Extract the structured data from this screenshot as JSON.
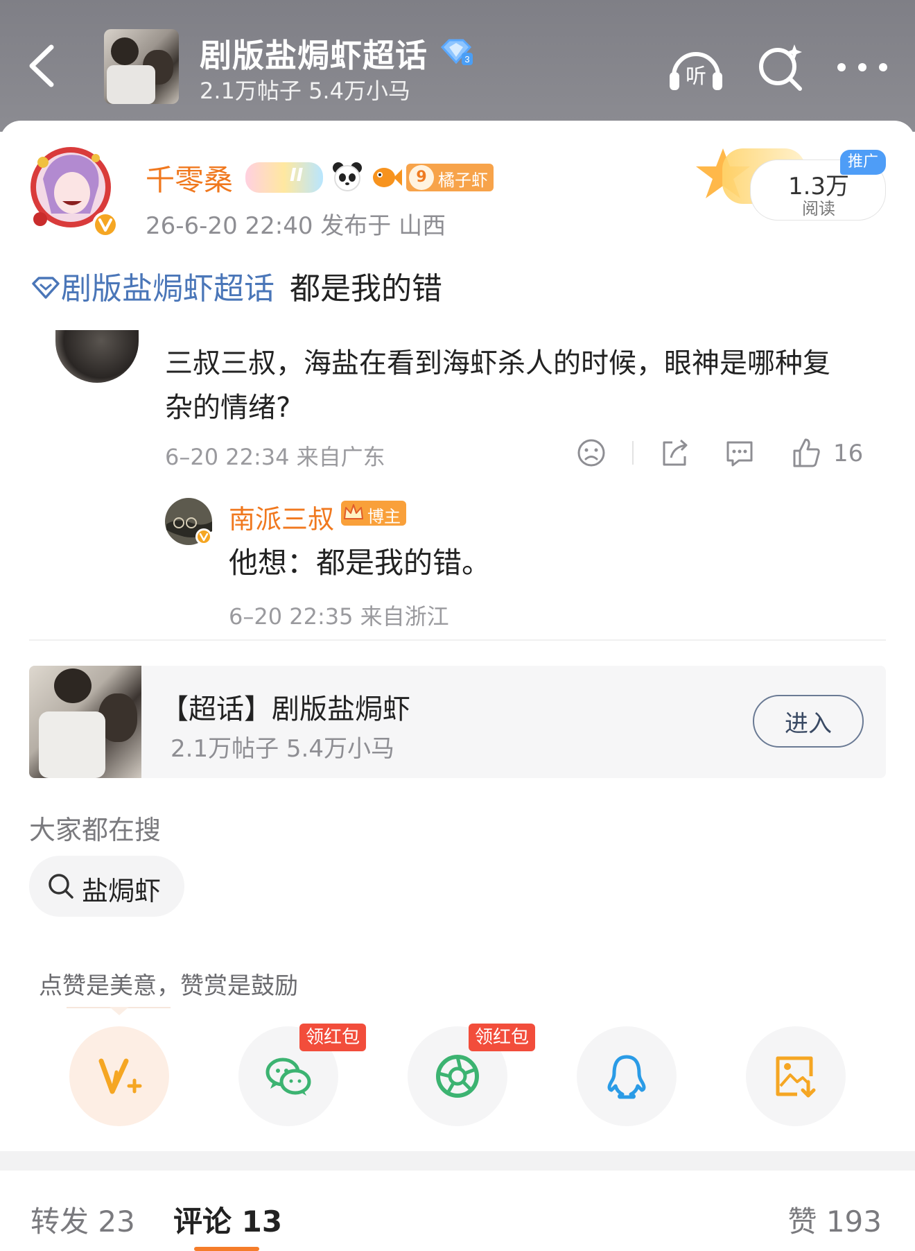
{
  "header": {
    "title": "剧版盐焗虾超话",
    "subtitle": "2.1万帖子 5.4万小马",
    "icons": [
      "back-arrow-icon",
      "listen-icon",
      "search-icon",
      "more-icon"
    ],
    "listen_label": "听"
  },
  "post": {
    "author": "千零桑",
    "level_badge": "II",
    "fan_badge_level": "9",
    "fan_badge_label": "橘子虾",
    "meta": "26-6-20 22:40  发布于 山西",
    "reads": "1.3万",
    "reads_label": "阅读",
    "promo_tag": "推广",
    "topic_link": "剧版盐焗虾超话",
    "text": "都是我的错"
  },
  "quoted_comment": {
    "text": "三叔三叔，海盐在看到海虾杀人的时候，眼神是哪种复杂的情绪?",
    "meta": "6–20 22:34  来自广东",
    "likes": "16"
  },
  "reply": {
    "author": "南派三叔",
    "badge": "博主",
    "text": "他想：都是我的错。",
    "meta": "6–20 22:35  来自浙江"
  },
  "topic_card": {
    "title": "【超话】剧版盐焗虾",
    "subtitle": "2.1万帖子 5.4万小马",
    "enter_label": "进入"
  },
  "hot_search": {
    "label": "大家都在搜",
    "query": "盐焗虾"
  },
  "tip": "点赞是美意，赞赏是鼓励",
  "share": {
    "red_tag": "领红包",
    "colors": {
      "weibo_v": "#f5a623",
      "wechat": "#3cb371",
      "moments": "#3cb371",
      "qq": "#2a9be6",
      "save": "#f5a623"
    }
  },
  "tabs": {
    "repost": "转发 23",
    "comment": "评论 13",
    "like": "赞 193"
  },
  "colors": {
    "accent": "#f0781e",
    "topic_link": "#4a76b8"
  }
}
